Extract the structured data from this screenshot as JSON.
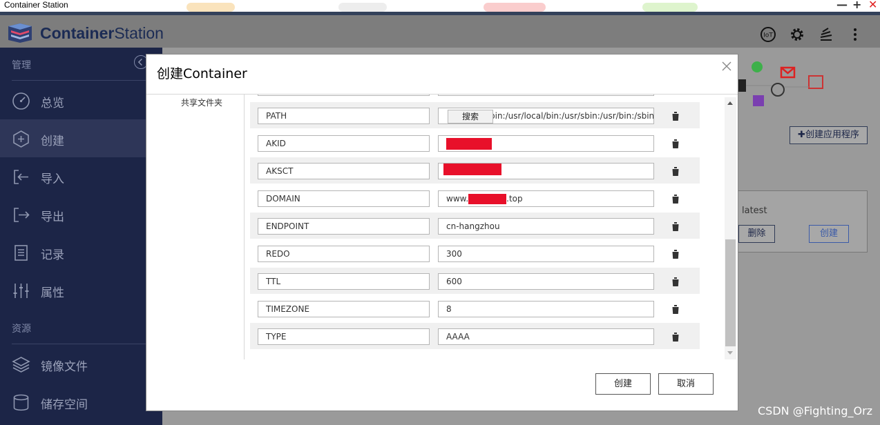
{
  "window": {
    "title": "Container Station",
    "minimize": "—",
    "maximize": "+",
    "close": "✕"
  },
  "header": {
    "brand_bold": "Container",
    "brand_light": "Station",
    "icons": [
      "iot-icon",
      "gear-icon",
      "stack-icon",
      "more-vert-icon"
    ],
    "iot_label": "IoT"
  },
  "sidebar": {
    "section_manage": "管理",
    "section_resources": "资源",
    "items": [
      {
        "label": "总览",
        "icon": "dashboard-icon"
      },
      {
        "label": "创建",
        "icon": "create-icon",
        "active": true
      },
      {
        "label": "导入",
        "icon": "import-icon"
      },
      {
        "label": "导出",
        "icon": "export-icon"
      },
      {
        "label": "记录",
        "icon": "log-icon"
      },
      {
        "label": "属性",
        "icon": "properties-icon"
      },
      {
        "label": "镜像文件",
        "icon": "images-icon"
      },
      {
        "label": "储存空间",
        "icon": "storage-icon"
      }
    ]
  },
  "background": {
    "create_app_button": "创建应用程序",
    "tag_text": "latest",
    "delete_button": "删除",
    "create_button": "创建"
  },
  "modal": {
    "title": "创建Container",
    "side_label": "共享文件夹",
    "tooltip": "搜索",
    "env_rows": [
      {
        "key": "PATH",
        "value": "/usr/local/sbin:/usr/local/bin:/usr/sbin:/usr/bin:/sbin:/bin",
        "visible_value": "bin:/usr/local/bin:/usr/sbin:/usr/bin:/sbin:/t"
      },
      {
        "key": "AKID",
        "value": ""
      },
      {
        "key": "AKSCT",
        "value": ""
      },
      {
        "key": "DOMAIN",
        "value_prefix": "www.",
        "value_suffix": ".top"
      },
      {
        "key": "ENDPOINT",
        "value": "cn-hangzhou"
      },
      {
        "key": "REDO",
        "value": "300"
      },
      {
        "key": "TTL",
        "value": "600"
      },
      {
        "key": "TIMEZONE",
        "value": "8"
      },
      {
        "key": "TYPE",
        "value": "AAAA"
      }
    ],
    "create_button": "创建",
    "cancel_button": "取消"
  },
  "watermark": "CSDN @Fighting_Orz",
  "colors": {
    "sidebar_bg": "#1c2547",
    "brand": "#1b2b54",
    "redaction": "#e8102a",
    "close_red": "#e02020"
  }
}
